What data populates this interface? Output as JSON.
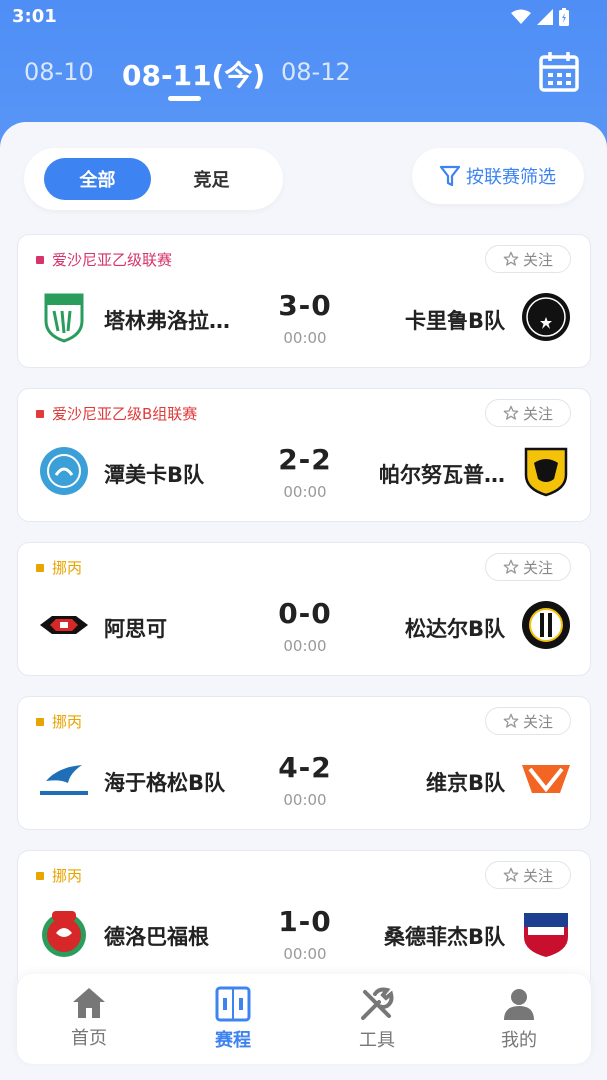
{
  "status": {
    "time": "3:01"
  },
  "dates": {
    "prev": "08-10",
    "today": "08-11(今)",
    "next": "08-12"
  },
  "filter": {
    "all": "全部",
    "jingzu": "竞足",
    "league_filter": "按联赛筛选"
  },
  "follow_label": "关注",
  "matches": [
    {
      "league": "爱沙尼亚乙级联赛",
      "league_color": "#d6336c",
      "home": "塔林弗洛拉…",
      "away": "卡里鲁B队",
      "score": "3-0",
      "time": "00:00"
    },
    {
      "league": "爱沙尼亚乙级B组联赛",
      "league_color": "#e03a3a",
      "home": "潭美卡B队",
      "away": "帕尔努瓦普…",
      "score": "2-2",
      "time": "00:00"
    },
    {
      "league": "挪丙",
      "league_color": "#e8a400",
      "home": "阿思可",
      "away": "松达尔B队",
      "score": "0-0",
      "time": "00:00"
    },
    {
      "league": "挪丙",
      "league_color": "#e8a400",
      "home": "海于格松B队",
      "away": "维京B队",
      "score": "4-2",
      "time": "00:00"
    },
    {
      "league": "挪丙",
      "league_color": "#e8a400",
      "home": "德洛巴福根",
      "away": "桑德菲杰B队",
      "score": "1-0",
      "time": "00:00"
    }
  ],
  "nav": [
    {
      "label": "首页",
      "icon": "home-icon"
    },
    {
      "label": "赛程",
      "icon": "schedule-icon"
    },
    {
      "label": "工具",
      "icon": "tools-icon"
    },
    {
      "label": "我的",
      "icon": "user-icon"
    }
  ],
  "colors": {
    "brand": "#3d83f2",
    "header": "#5b98f7"
  }
}
